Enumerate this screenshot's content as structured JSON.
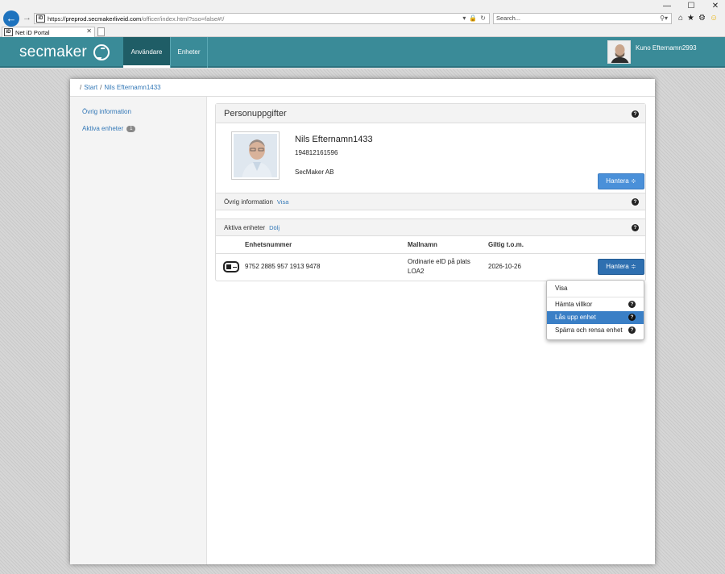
{
  "browser": {
    "url_scheme": "https://",
    "url_domain": "preprod.secmakerliveid.com",
    "url_path": "/officer/index.html?sso=false#!/",
    "search_placeholder": "Search...",
    "tab_title": "Net iD Portal",
    "site_icon_text": "iD",
    "icons": [
      "back-arrow-icon",
      "forward-arrow-icon",
      "lock-icon",
      "refresh-icon",
      "search-icon",
      "home-icon",
      "star-icon",
      "gear-icon",
      "smiley-icon"
    ]
  },
  "header": {
    "logo_text": "secmaker",
    "nav": [
      {
        "label": "Användare",
        "active": true
      },
      {
        "label": "Enheter",
        "active": false
      }
    ],
    "user_name": "Kuno Efternamn2993",
    "accent_color": "#3a8b98"
  },
  "breadcrumb": {
    "start": "Start",
    "current": "Nils Efternamn1433"
  },
  "sidebar": {
    "items": [
      {
        "label": "Övrig information"
      },
      {
        "label": "Aktiva enheter",
        "badge": "1"
      }
    ]
  },
  "person_panel": {
    "title": "Personuppgifter",
    "name": "Nils Efternamn1433",
    "personal_number": "194812161596",
    "organization": "SecMaker AB",
    "manage_button": "Hantera ≑"
  },
  "other_info": {
    "title": "Övrig information",
    "toggle": "Visa"
  },
  "active_devices": {
    "title": "Aktiva enheter",
    "toggle": "Dölj",
    "columns": [
      "Enhetsnummer",
      "Mallnamn",
      "Giltig t.o.m."
    ],
    "rows": [
      {
        "device_number": "9752 2885 957 1913 9478",
        "template_line1": "Ordinarie eID på plats",
        "template_line2": "LOA2",
        "valid_until": "2026-10-26",
        "action": "Hantera ≑"
      }
    ]
  },
  "dropdown": {
    "items": [
      {
        "label": "Visa",
        "help": false
      },
      {
        "label": "Hämta villkor",
        "help": true
      },
      {
        "label": "Lås upp enhet",
        "help": true,
        "highlighted": true
      },
      {
        "label": "Spärra och rensa enhet",
        "help": true
      }
    ],
    "highlight_color": "#3a7fc6"
  }
}
